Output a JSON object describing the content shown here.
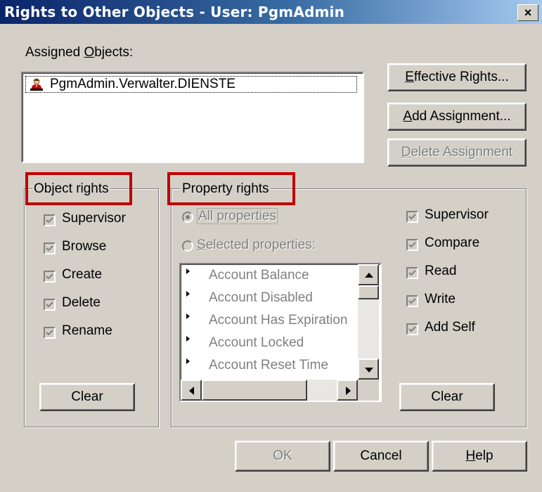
{
  "window": {
    "title": "Rights to Other Objects - User: PgmAdmin",
    "close_glyph": "×"
  },
  "assigned": {
    "label_pre": "Assigned ",
    "label_mnemonic": "O",
    "label_post": "bjects:",
    "items": [
      "PgmAdmin.Verwalter.DIENSTE"
    ]
  },
  "buttons": {
    "effective_rights": {
      "mn": "E",
      "rest": "ffective Rights..."
    },
    "add_assignment": {
      "mn": "A",
      "rest": "dd Assignment..."
    },
    "delete_assignment": {
      "mn": "D",
      "rest": "elete Assignment"
    },
    "ok": "OK",
    "cancel": "Cancel",
    "help": {
      "mn": "H",
      "rest": "elp"
    },
    "clear": "Clear"
  },
  "object_rights": {
    "legend": "Object rights",
    "items": [
      {
        "label": "Supervisor",
        "checked": true
      },
      {
        "label": "Browse",
        "checked": true
      },
      {
        "label": "Create",
        "checked": true
      },
      {
        "label": "Delete",
        "checked": true
      },
      {
        "label": "Rename",
        "checked": true
      }
    ]
  },
  "property_rights": {
    "legend": "Property rights",
    "radio_all": "All properties",
    "radio_selected_mn": "S",
    "radio_selected_rest": "elected properties:",
    "list": [
      "Account Balance",
      "Account Disabled",
      "Account Has Expiration",
      "Account Locked",
      "Account Reset Time"
    ],
    "items": [
      {
        "label": "Supervisor",
        "checked": true
      },
      {
        "label": "Compare",
        "checked": true
      },
      {
        "label": "Read",
        "checked": true
      },
      {
        "label": "Write",
        "checked": true
      },
      {
        "label": "Add Self",
        "checked": true
      }
    ]
  },
  "colors": {
    "highlight_box": "#c00000",
    "title_bar": "#0a246a",
    "face": "#d4d0c8"
  }
}
